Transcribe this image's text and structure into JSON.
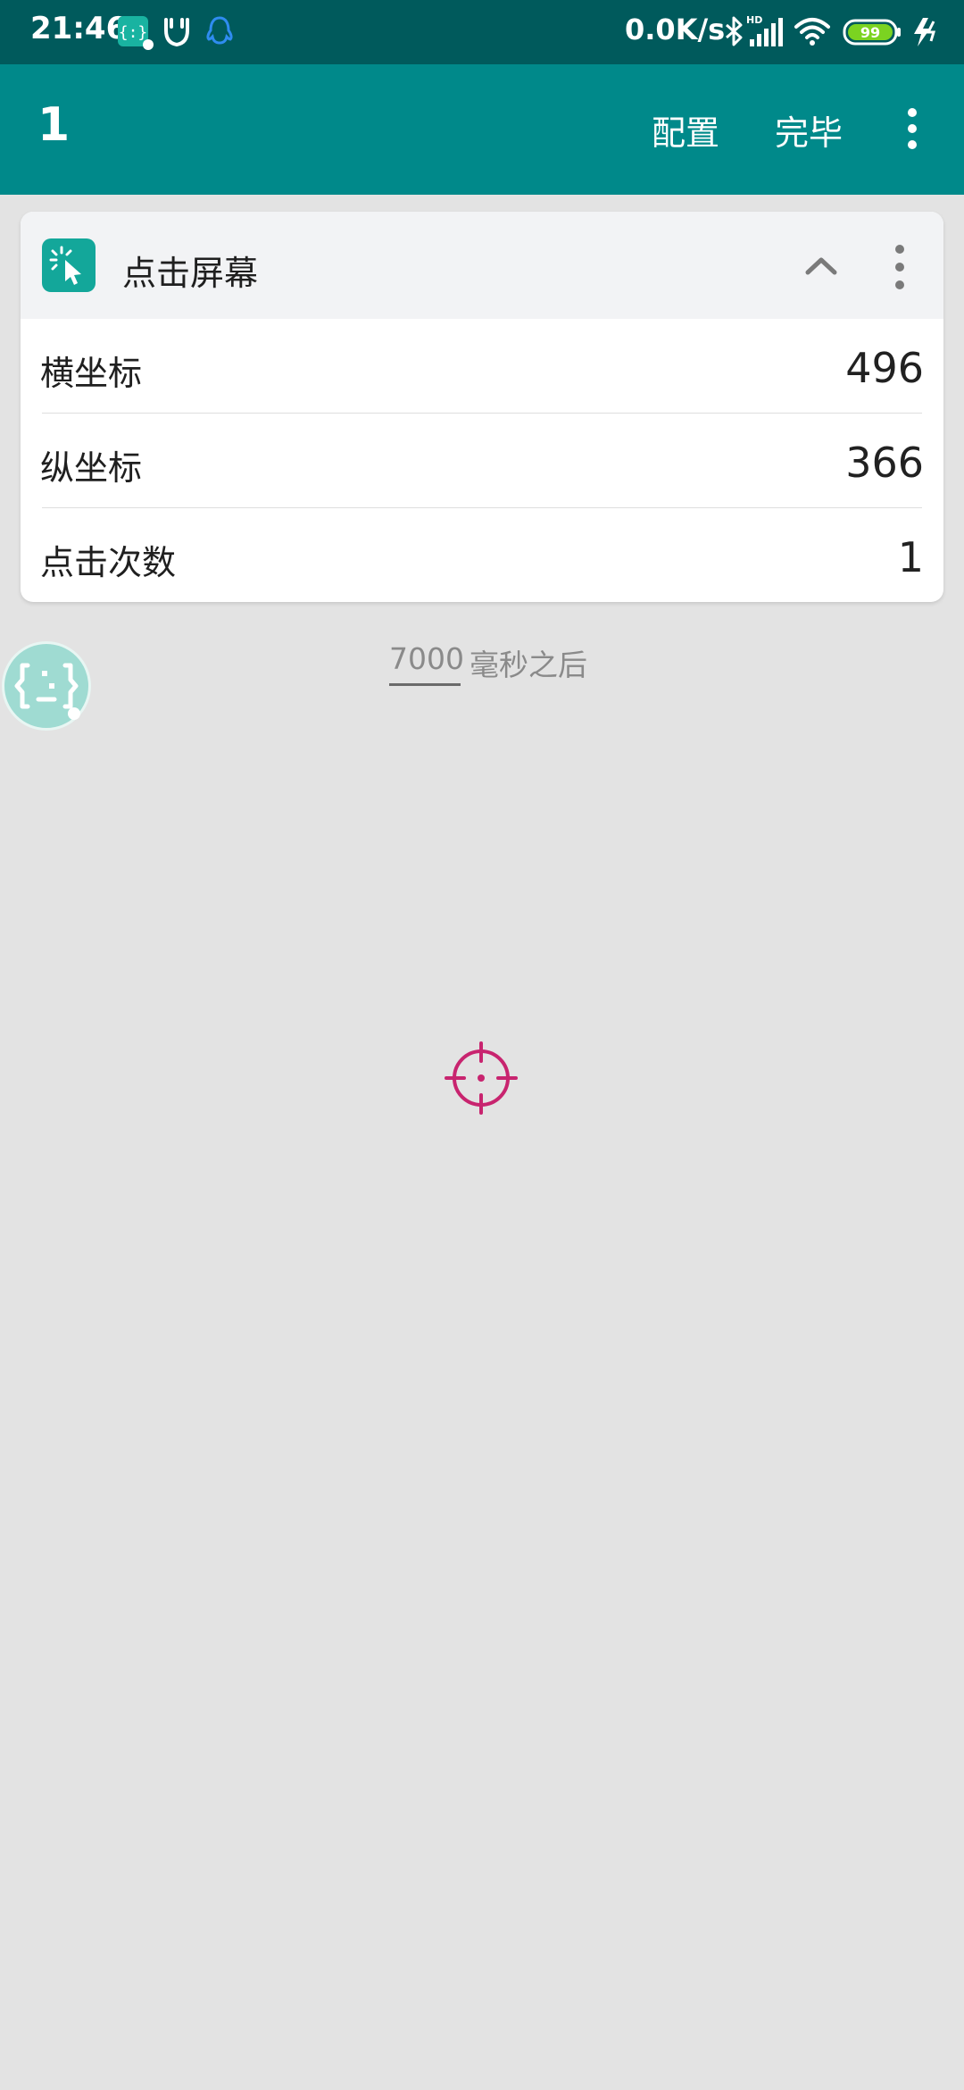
{
  "status_bar": {
    "time": "21:46",
    "net_speed": "0.0K/s",
    "battery": "99",
    "left_icons": [
      "scan-app-icon",
      "mijia-icon",
      "qq-icon"
    ],
    "right_icons": [
      "bluetooth-icon",
      "hd-signal-icon",
      "wifi-icon",
      "battery-icon",
      "charging-icon"
    ]
  },
  "toolbar": {
    "title": "1",
    "config_label": "配置",
    "done_label": "完毕"
  },
  "card": {
    "title": "点击屏幕",
    "rows": [
      {
        "label": "横坐标",
        "value": "496"
      },
      {
        "label": "纵坐标",
        "value": "366"
      },
      {
        "label": "点击次数",
        "value": "1"
      }
    ]
  },
  "delay": {
    "value": "7000",
    "suffix": "毫秒之后"
  },
  "colors": {
    "status_bar": "#005a5c",
    "toolbar": "#00898a",
    "accent_teal": "#13a79a",
    "crosshair": "#c8246f",
    "background": "#e3e3e3"
  }
}
